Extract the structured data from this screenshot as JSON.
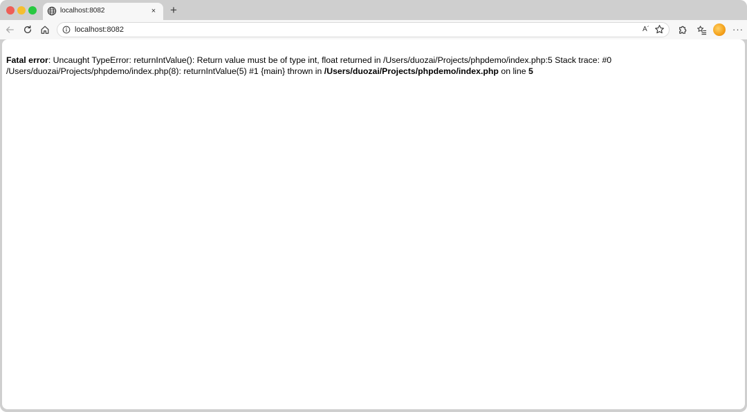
{
  "browser": {
    "tab": {
      "title": "localhost:8082",
      "close_glyph": "×",
      "icon": "globe-icon"
    },
    "new_tab_glyph": "+",
    "address_bar": {
      "url": "localhost:8082",
      "read_aloud_label": "A´"
    },
    "more_glyph": "···"
  },
  "page": {
    "error_label": "Fatal error",
    "error_message": ": Uncaught TypeError: returnIntValue(): Return value must be of type int, float returned in /Users/duozai/Projects/phpdemo/index.php:5 Stack trace: #0 /Users/duozai/Projects/phpdemo/index.php(8): returnIntValue(5) #1 {main} thrown in ",
    "error_file": "/Users/duozai/Projects/phpdemo/index.php",
    "on_line_text": " on line ",
    "line_number": "5"
  },
  "colors": {
    "traffic_close": "#ee5e57",
    "traffic_minimize": "#f5be2f",
    "traffic_maximize": "#28c840",
    "chrome_bg": "#cfcfcf",
    "toolbar_bg": "#f7f7f7"
  }
}
